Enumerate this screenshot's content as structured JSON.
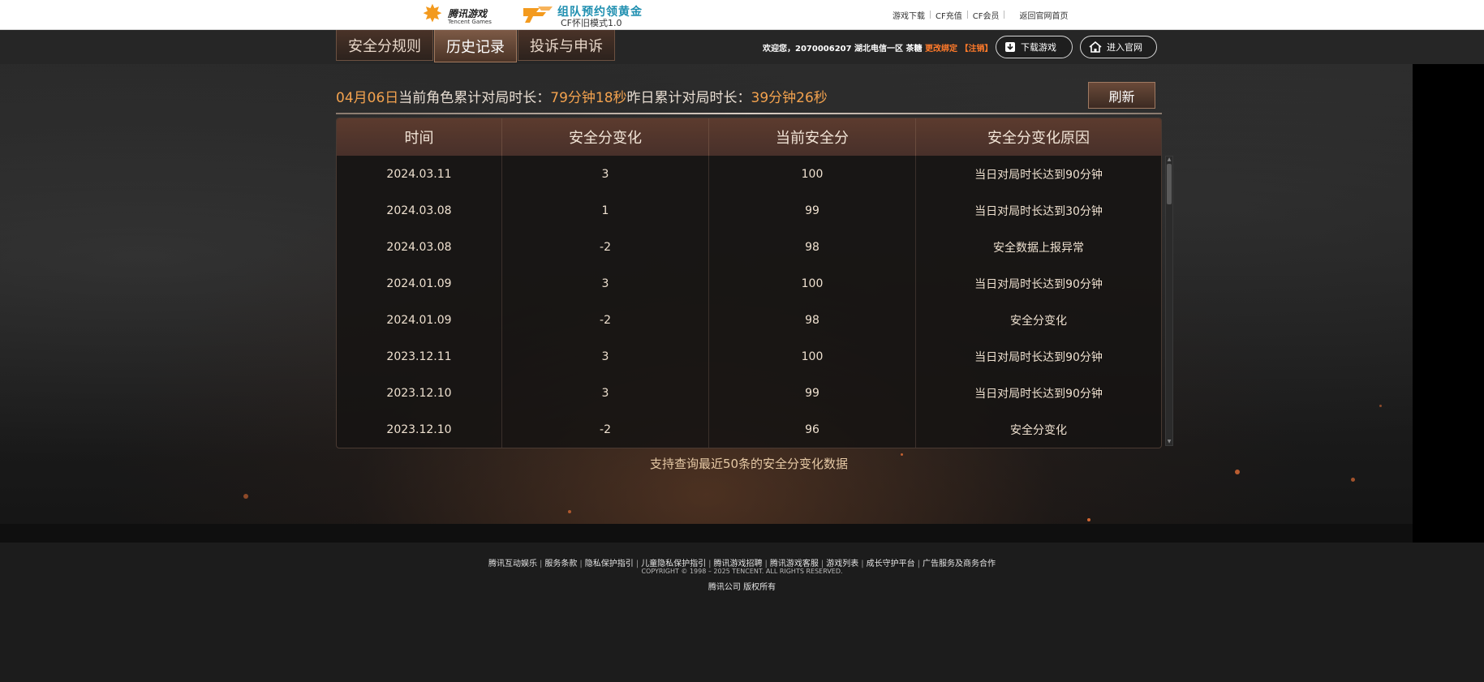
{
  "topbar": {
    "tencent_logo": {
      "cn": "腾讯游戏",
      "en": "Tencent Games"
    },
    "cf_logo": {
      "line1": "组队预约领黄金",
      "line2": "CF怀旧模式1.0"
    },
    "links": [
      "游戏下载",
      "CF充值",
      "CF会员",
      "返回官网首页"
    ]
  },
  "nav": {
    "tabs": [
      "安全分规则",
      "历史记录",
      "投诉与申诉"
    ],
    "active_tab": "历史记录",
    "welcome": {
      "prefix": "欢迎您，2070006207 湖北电信一区 茶糖",
      "change_binding": "更改绑定",
      "logout": "【注销】"
    },
    "download_button": "下载游戏",
    "home_button": "进入官网"
  },
  "stats": {
    "date": "04月06日",
    "current_label": "当前角色累计对局时长：",
    "current_value": "79分钟18秒",
    "yesterday_label": "昨日累计对局时长：",
    "yesterday_value": "39分钟26秒"
  },
  "refresh_label": "刷新",
  "table": {
    "headers": [
      "时间",
      "安全分变化",
      "当前安全分",
      "安全分变化原因"
    ],
    "rows": [
      [
        "2024.03.11",
        "3",
        "100",
        "当日对局时长达到90分钟"
      ],
      [
        "2024.03.08",
        "1",
        "99",
        "当日对局时长达到30分钟"
      ],
      [
        "2024.03.08",
        "-2",
        "98",
        "安全数据上报异常"
      ],
      [
        "2024.01.09",
        "3",
        "100",
        "当日对局时长达到90分钟"
      ],
      [
        "2024.01.09",
        "-2",
        "98",
        "安全分变化"
      ],
      [
        "2023.12.11",
        "3",
        "100",
        "当日对局时长达到90分钟"
      ],
      [
        "2023.12.10",
        "3",
        "99",
        "当日对局时长达到90分钟"
      ],
      [
        "2023.12.10",
        "-2",
        "96",
        "安全分变化"
      ]
    ]
  },
  "note": "支持查询最近50条的安全分变化数据",
  "footer": {
    "links": [
      "腾讯互动娱乐",
      "服务条款",
      "隐私保护指引",
      "儿童隐私保护指引",
      "腾讯游戏招聘",
      "腾讯游戏客服",
      "游戏列表",
      "成长守护平台",
      "广告服务及商务合作"
    ],
    "copyright": "COPYRIGHT © 1998 – 2025 TENCENT. ALL RIGHTS RESERVED.",
    "corp": "腾讯公司 版权所有"
  },
  "colors": {
    "accent_orange": "#f3a24e",
    "warn_orange": "#ff7a2a",
    "header_brown": "#5c3b2e"
  },
  "icons": [
    "tencent-games-logo",
    "cf-wing-logo",
    "download-icon",
    "home-icon"
  ]
}
